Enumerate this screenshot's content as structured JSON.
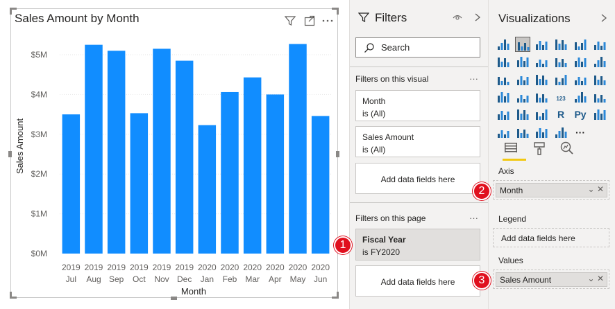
{
  "visual": {
    "title": "Sales Amount by Month",
    "icons": [
      "filter-icon",
      "focus-mode-icon",
      "more-options-icon"
    ]
  },
  "chart_data": {
    "type": "bar",
    "title": "Sales Amount by Month",
    "xlabel": "Month",
    "ylabel": "Sales Amount",
    "ylim": [
      0,
      5500000
    ],
    "yticks": [
      "$0M",
      "$1M",
      "$2M",
      "$3M",
      "$4M",
      "$5M"
    ],
    "categories": [
      {
        "year": "2019",
        "month": "Jul"
      },
      {
        "year": "2019",
        "month": "Aug"
      },
      {
        "year": "2019",
        "month": "Sep"
      },
      {
        "year": "2019",
        "month": "Oct"
      },
      {
        "year": "2019",
        "month": "Nov"
      },
      {
        "year": "2019",
        "month": "Dec"
      },
      {
        "year": "2020",
        "month": "Jan"
      },
      {
        "year": "2020",
        "month": "Feb"
      },
      {
        "year": "2020",
        "month": "Mar"
      },
      {
        "year": "2020",
        "month": "Apr"
      },
      {
        "year": "2020",
        "month": "May"
      },
      {
        "year": "2020",
        "month": "Jun"
      }
    ],
    "values": [
      3500000,
      5250000,
      5100000,
      3530000,
      5150000,
      4850000,
      3230000,
      4060000,
      4430000,
      4000000,
      5270000,
      3460000
    ],
    "color": "#118dff",
    "grid": true,
    "legend": "none"
  },
  "filters": {
    "title": "Filters",
    "search_placeholder": "Search",
    "on_visual_label": "Filters on this visual",
    "on_page_label": "Filters on this page",
    "more": "···",
    "visual_cards": [
      {
        "name": "Month",
        "value": "is (All)"
      },
      {
        "name": "Sales Amount",
        "value": "is (All)"
      }
    ],
    "page_cards": [
      {
        "name": "Fiscal Year",
        "value": "is FY2020"
      }
    ],
    "add_fields": "Add data fields here"
  },
  "visualizations": {
    "title": "Visualizations",
    "more": "···",
    "axis_label": "Axis",
    "legend_label": "Legend",
    "values_label": "Values",
    "axis_field": "Month",
    "values_field": "Sales Amount",
    "add_fields": "Add data fields here",
    "tabs": [
      "fields-tab-icon",
      "format-tab-icon",
      "analytics-tab-icon"
    ]
  },
  "callouts": [
    "1",
    "2",
    "3"
  ]
}
